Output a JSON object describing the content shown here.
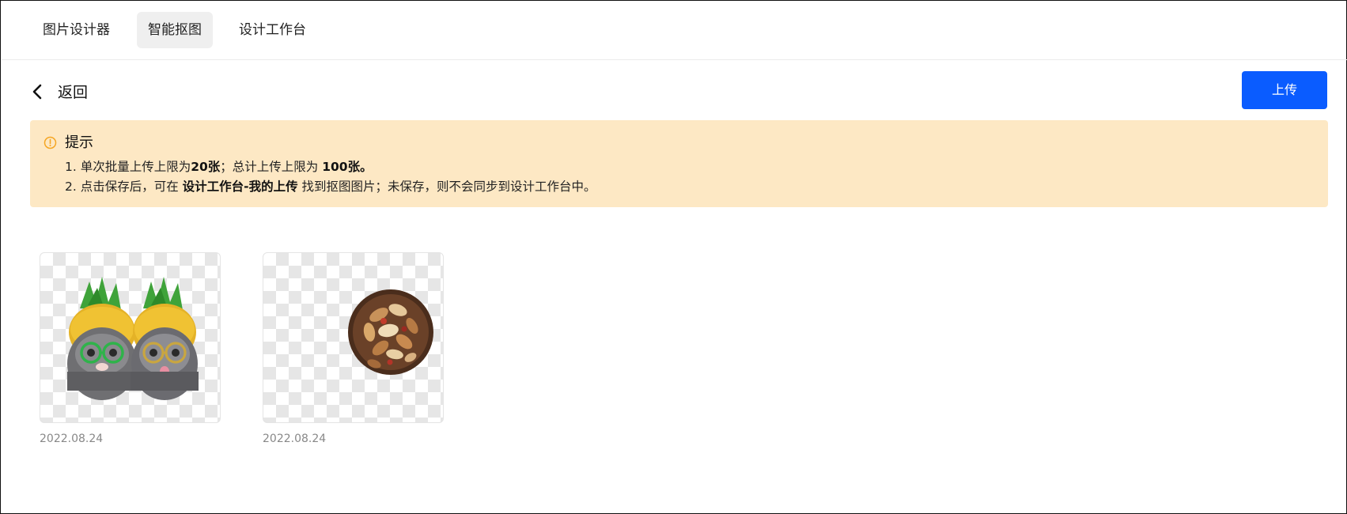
{
  "nav": {
    "tabs": [
      {
        "label": "图片设计器",
        "active": false
      },
      {
        "label": "智能抠图",
        "active": true
      },
      {
        "label": "设计工作台",
        "active": false
      }
    ]
  },
  "toolbar": {
    "back_label": "返回",
    "upload_label": "上传"
  },
  "tip": {
    "title": "提示",
    "line1": {
      "pre": "1. 单次批量上传上限为",
      "b1": "20张",
      "mid": "；总计上传上限为 ",
      "b2": "100张。"
    },
    "line2": {
      "pre": "2. 点击保存后，可在 ",
      "b1": "设计工作台-我的上传",
      "post": " 找到抠图图片；未保存，则不会同步到设计工作台中。"
    }
  },
  "images": [
    {
      "date": "2022.08.24",
      "subject": "two-kittens-pineapple-hats"
    },
    {
      "date": "2022.08.24",
      "subject": "bowl-of-mixed-nuts"
    }
  ],
  "colors": {
    "accent": "#0a5cff",
    "tip_bg": "#fde8c4",
    "tip_icon": "#f5a623"
  }
}
